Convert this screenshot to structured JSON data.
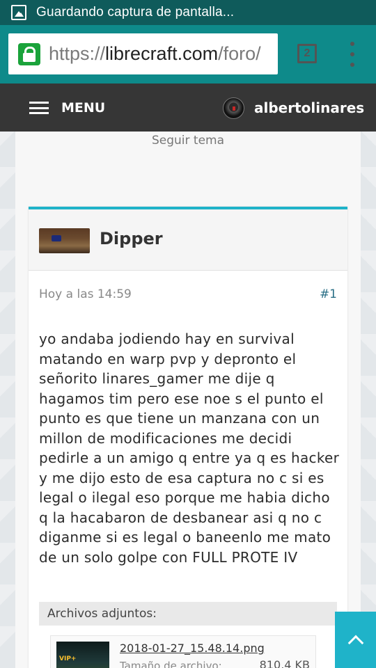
{
  "status_bar": {
    "notification": "Guardando captura de pantalla..."
  },
  "browser": {
    "url_scheme": "https://",
    "url_host": "librecraft.com",
    "url_path": "/foro/",
    "tab_count": "2"
  },
  "nav": {
    "menu_label": "MENU",
    "username": "albertolinares"
  },
  "thread": {
    "follow_label": "Seguir tema"
  },
  "post": {
    "author": "Dipper",
    "time": "Hoy a las 14:59",
    "number": "#1",
    "body": "yo andaba jodiendo hay en survival matando en warp pvp y depronto el señorito linares_gamer me dije q hagamos tim pero ese noe s el punto el punto es que tiene un manzana con un millon de modificaciones me decidi pedirle a un amigo q entre ya q es hacker y me dijo esto de esa captura no c si es legal o ilegal eso porque me habia dicho q la hacabaron de desbanear asi q no c diganme si es legal o baneenlo me mato de un solo golpe con FULL PROTE IV",
    "attachments_label": "Archivos adjuntos:",
    "attachment": {
      "filename": "2018-01-27_15.48.14.png",
      "size_label": "Tamaño de archivo:",
      "size": "810,4 KB"
    }
  },
  "colors": {
    "accent": "#1fb3c9",
    "status_bar": "#0f5b5b",
    "browser_bar": "#0e8a8a",
    "nav_bg": "#363636",
    "lock": "#1aa33b"
  }
}
